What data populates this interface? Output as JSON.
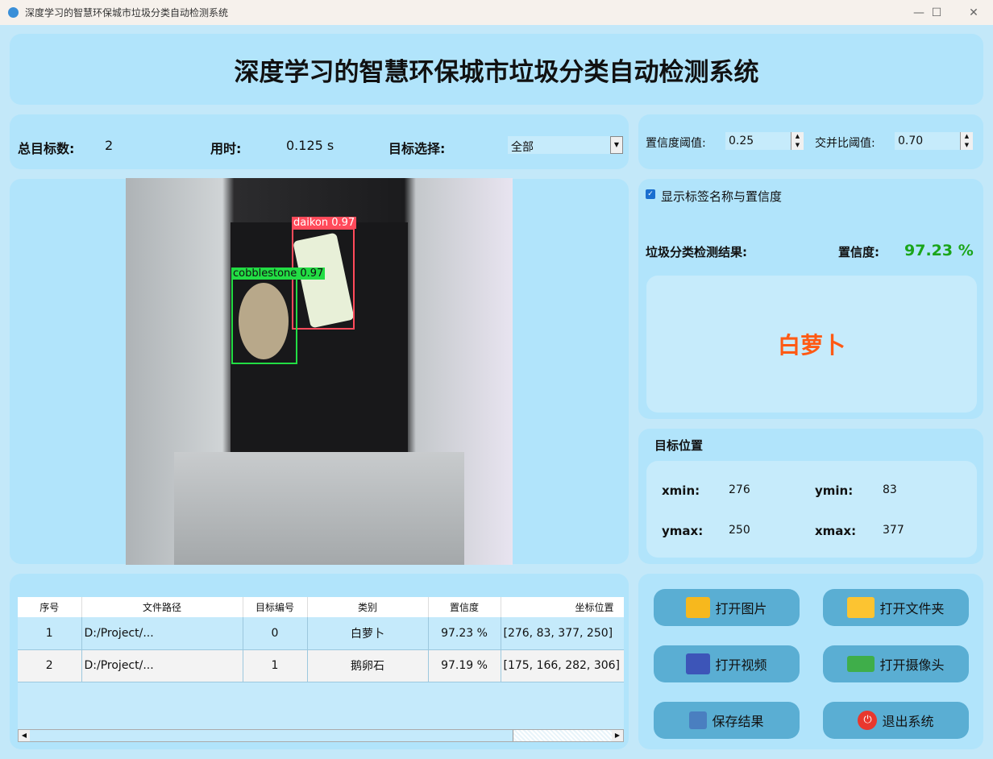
{
  "window": {
    "title": "深度学习的智慧环保城市垃圾分类自动检测系统"
  },
  "header": {
    "title": "深度学习的智慧环保城市垃圾分类自动检测系统"
  },
  "stats": {
    "total_label": "总目标数:",
    "total_value": "2",
    "time_label": "用时:",
    "time_value": "0.125 s",
    "select_label": "目标选择:",
    "select_value": "全部"
  },
  "thresholds": {
    "conf_label": "置信度阈值:",
    "conf_value": "0.25",
    "iou_label": "交并比阈值:",
    "iou_value": "0.70"
  },
  "image": {
    "detections": [
      {
        "label": "daikon  0.97",
        "color": "#ff4a5a"
      },
      {
        "label": "cobblestone  0.97",
        "color": "#22dd44"
      }
    ]
  },
  "result": {
    "show_labels": "显示标签名称与置信度",
    "result_label": "垃圾分类检测结果:",
    "conf_label": "置信度:",
    "conf_value": "97.23 %",
    "class_name": "白萝卜",
    "accent": "#ff5a14",
    "conf_color": "#1aa51a"
  },
  "position": {
    "title": "目标位置",
    "xmin_label": "xmin:",
    "xmin": "276",
    "ymin_label": "ymin:",
    "ymin": "83",
    "ymax_label": "ymax:",
    "ymax": "250",
    "xmax_label": "xmax:",
    "xmax": "377"
  },
  "table": {
    "headers": [
      "序号",
      "文件路径",
      "目标编号",
      "类别",
      "置信度",
      "坐标位置"
    ],
    "rows": [
      [
        "1",
        "D:/Project/...",
        "0",
        "白萝卜",
        "97.23 %",
        "[276, 83, 377, 250]"
      ],
      [
        "2",
        "D:/Project/...",
        "1",
        "鹅卵石",
        "97.19 %",
        "[175, 166, 282, 306]"
      ]
    ]
  },
  "buttons": {
    "open_image": "打开图片",
    "open_folder": "打开文件夹",
    "open_video": "打开视频",
    "open_camera": "打开摄像头",
    "save": "保存结果",
    "exit": "退出系统"
  }
}
